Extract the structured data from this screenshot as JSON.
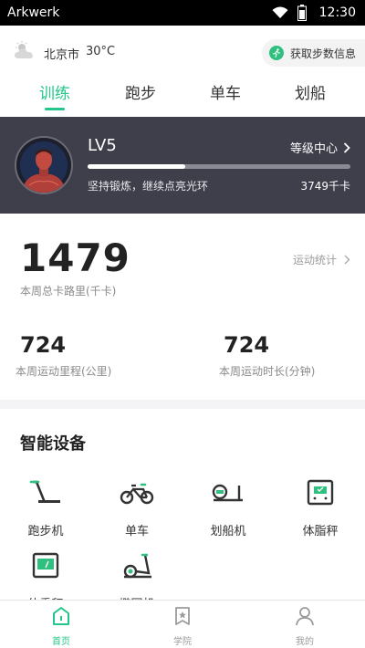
{
  "status_bar": {
    "app_name": "Arkwerk",
    "time": "12:30"
  },
  "weather": {
    "city": "北京市",
    "temperature": "30°C",
    "icon": "partly-cloudy-icon"
  },
  "get_steps_button": {
    "label": "获取步数信息",
    "icon": "runner-icon"
  },
  "tabs": [
    {
      "label": "训练",
      "active": true
    },
    {
      "label": "跑步",
      "active": false
    },
    {
      "label": "单车",
      "active": false
    },
    {
      "label": "划船",
      "active": false
    }
  ],
  "level_card": {
    "level": "LV5",
    "level_center_label": "等级中心",
    "progress_fraction": 0.37,
    "motto": "坚持锻炼，继续点亮光环",
    "calories": "3749千卡"
  },
  "weekly": {
    "calories_value": "1479",
    "calories_label": "本周总卡路里(千卡)",
    "stats_link": "运动统计",
    "distance_value": "724",
    "distance_label": "本周运动里程(公里)",
    "duration_value": "724",
    "duration_label": "本周运动时长(分钟)"
  },
  "devices": {
    "title": "智能设备",
    "items": [
      {
        "label": "跑步机",
        "icon": "treadmill-icon"
      },
      {
        "label": "单车",
        "icon": "bicycle-icon"
      },
      {
        "label": "划船机",
        "icon": "rowing-machine-icon"
      },
      {
        "label": "体脂秤",
        "icon": "body-fat-scale-icon"
      },
      {
        "label": "体重秤",
        "icon": "weight-scale-icon"
      },
      {
        "label": "椭圆机",
        "icon": "elliptical-icon"
      }
    ]
  },
  "bottom_nav": [
    {
      "label": "首页",
      "icon": "home-icon",
      "active": true
    },
    {
      "label": "学院",
      "icon": "academy-icon",
      "active": false
    },
    {
      "label": "我的",
      "icon": "profile-icon",
      "active": false
    }
  ],
  "colors": {
    "accent": "#24c789",
    "card_bg": "#3e3f4b"
  }
}
